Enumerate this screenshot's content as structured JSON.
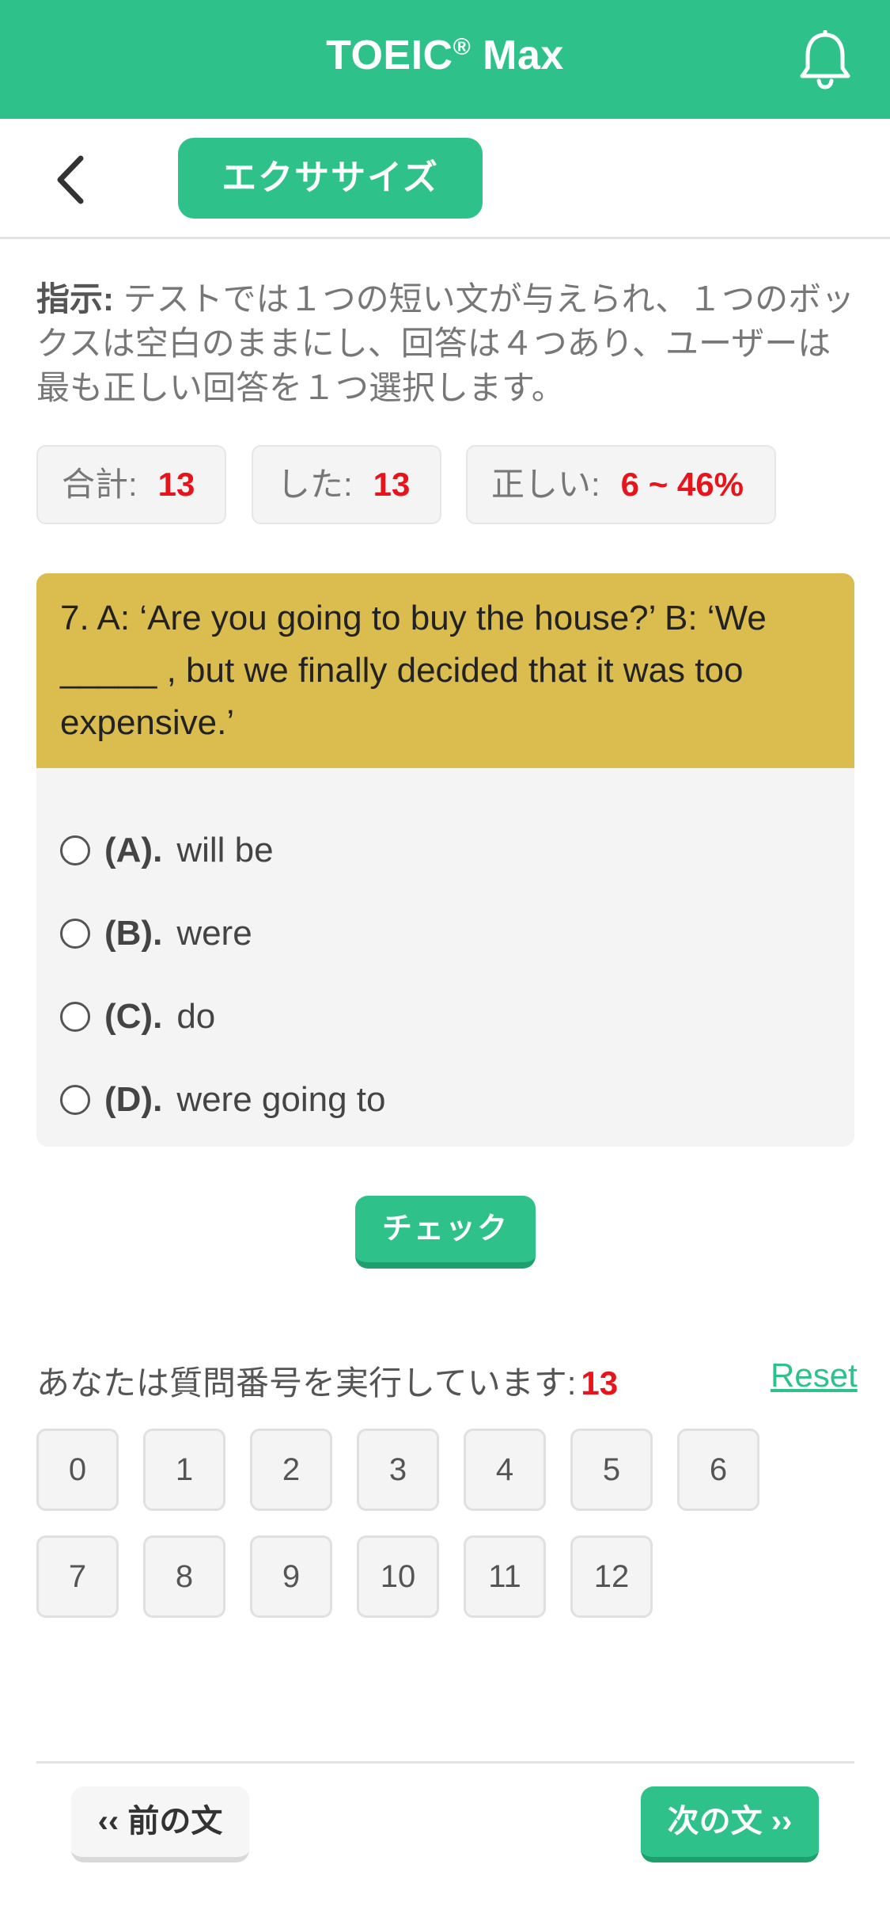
{
  "header": {
    "app_name": "TOEIC",
    "registered_mark": "®",
    "app_suffix": " Max",
    "notification_icon": "bell-icon",
    "accent_color": "#2ec28a"
  },
  "subheader": {
    "back_icon": "chevron-left-icon",
    "exercise_label": "エクササイズ"
  },
  "instruction": {
    "label": "指示:",
    "text": " テストでは１つの短い文が与えられ、１つのボックスは空白のままにし、回答は４つあり、ユーザーは最も正しい回答を１つ選択します。"
  },
  "stats": {
    "total_label": "合計:",
    "total_value": "13",
    "done_label": "した:",
    "done_value": "13",
    "correct_label": "正しい:",
    "correct_value": "6 ~ 46%"
  },
  "question": {
    "text": "7. A: ‘Are you going to buy the house?’ B: ‘We _____ , but we finally decided that it was too expensive.’",
    "options": [
      {
        "letter": "(A).",
        "text": "will be"
      },
      {
        "letter": "(B).",
        "text": "were"
      },
      {
        "letter": "(C).",
        "text": "do"
      },
      {
        "letter": "(D).",
        "text": "were going to"
      }
    ]
  },
  "check_label": "チェック",
  "progress": {
    "running_label": "あなたは質問番号を実行しています:",
    "running_value": "13",
    "reset_label": "Reset",
    "numbers": [
      "0",
      "1",
      "2",
      "3",
      "4",
      "5",
      "6",
      "7",
      "8",
      "9",
      "10",
      "11",
      "12"
    ]
  },
  "footer": {
    "prev_label": "‹‹ 前の文",
    "next_label": "次の文 ››"
  }
}
